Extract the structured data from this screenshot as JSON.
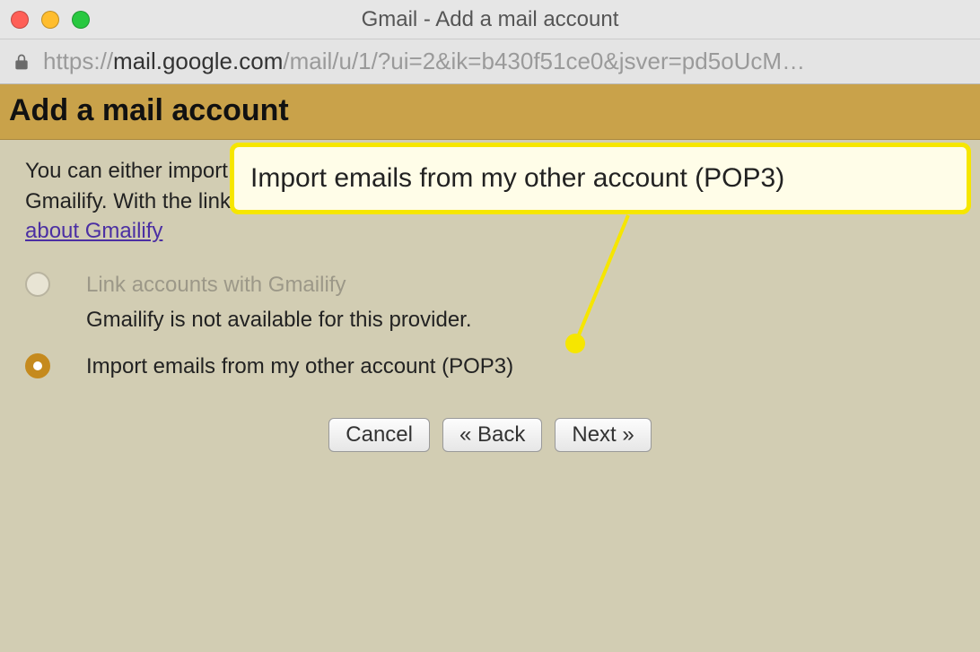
{
  "window": {
    "title": "Gmail - Add a mail account"
  },
  "address": {
    "protocol": "https://",
    "host": "mail.google.com",
    "path": "/mail/u/1/?ui=2&ik=b430f51ce0&jsver=pd5oUcM…"
  },
  "header": {
    "title": "Add a mail account"
  },
  "intro": {
    "text_prefix": "You can either import emails from contact@lifewiretest.33mail.com, or link the accounts using Gmailify. With the linked account, you'll manage emails from both using your Gmail inbox. ",
    "link_text": "More about Gmailify"
  },
  "options": {
    "gmailify": {
      "label": "Link accounts with Gmailify",
      "sub": "Gmailify is not available for this provider."
    },
    "pop3": {
      "label": "Import emails from my other account (POP3)"
    }
  },
  "buttons": {
    "cancel": "Cancel",
    "back": "« Back",
    "next": "Next »"
  },
  "callout": {
    "text": "Import emails from my other account (POP3)"
  }
}
